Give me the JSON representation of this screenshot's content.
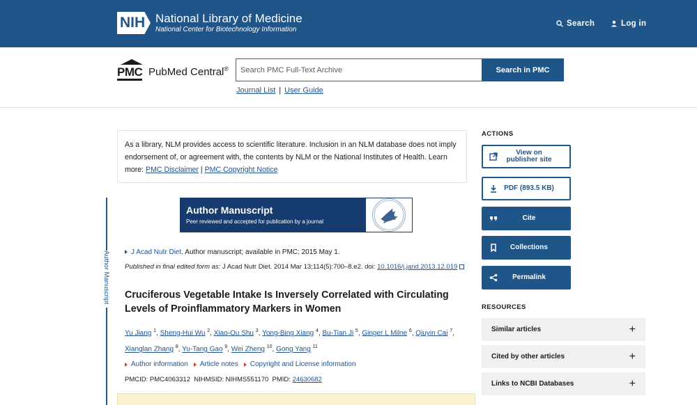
{
  "header": {
    "nih_mark": "NIH",
    "org_title": "National Library of Medicine",
    "org_subtitle": "National Center for Biotechnology Information",
    "search_label": "Search",
    "login_label": "Log in"
  },
  "pmc": {
    "logo_letters": "PMC",
    "logo_name": "PubMed Central",
    "logo_reg": "®",
    "search_placeholder": "Search PMC Full-Text Archive",
    "search_button": "Search in PMC",
    "journal_list": "Journal List",
    "separator": "|",
    "user_guide": "User Guide"
  },
  "disclaimer": {
    "text": "As a library, NLM provides access to scientific literature. Inclusion in an NLM database does not imply endorsement of, or agreement with, the contents by NLM or the National Institutes of Health. Learn more: ",
    "link1": "PMC Disclaimer",
    "sep": " | ",
    "link2": "PMC Copyright Notice"
  },
  "side_label": "Author Manuscript",
  "banner": {
    "title": "Author Manuscript",
    "subtitle": "Peer reviewed and accepted for publication by a journal"
  },
  "article": {
    "journal": "J Acad Nutr Diet",
    "journal_suffix": ". Author manuscript; available in PMC: 2015 May 1.",
    "published_prefix": "Published in final edited form as:",
    "published_text": " J Acad Nutr Diet. 2014 Mar 13;114(5):700–8.e2. doi: ",
    "doi": "10.1016/j.jand.2013.12.019",
    "title": "Cruciferous Vegetable Intake Is Inversely Correlated with Circulating Levels of Proinflammatory Markers in Women",
    "authors": [
      {
        "name": "Yu Jiang",
        "sup": "1"
      },
      {
        "name": "Sheng-Hui Wu",
        "sup": "2"
      },
      {
        "name": "Xiao-Ou Shu",
        "sup": "3"
      },
      {
        "name": "Yong-Bing Xiang",
        "sup": "4"
      },
      {
        "name": "Bu-Tian Ji",
        "sup": "5"
      },
      {
        "name": "Ginger L Milne",
        "sup": "6"
      },
      {
        "name": "Qiuyin Cai",
        "sup": "7"
      },
      {
        "name": "Xianglan Zhang",
        "sup": "8"
      },
      {
        "name": "Yu-Tang Gao",
        "sup": "9"
      },
      {
        "name": "Wei Zheng",
        "sup": "10"
      },
      {
        "name": "Gong Yang",
        "sup": "11"
      }
    ],
    "info_links": [
      "Author information",
      "Article notes",
      "Copyright and License information"
    ],
    "pmcid_label": "PMCID: PMC4063312",
    "nihmsid_label": "NIHMSID: NIHMS551170",
    "pmid_label": "PMID: ",
    "pmid": "24630682"
  },
  "actions": {
    "heading": "ACTIONS",
    "view_line1": "View on",
    "view_line2": "publisher site",
    "pdf": "PDF (893.5 KB)",
    "cite": "Cite",
    "collections": "Collections",
    "permalink": "Permalink"
  },
  "resources": {
    "heading": "RESOURCES",
    "items": [
      "Similar articles",
      "Cited by other articles",
      "Links to NCBI Databases"
    ],
    "expand_symbol": "+"
  },
  "colors": {
    "brand": "#20558a",
    "link": "#205493",
    "banner": "#163b6e",
    "accent_red": "#d83933"
  }
}
